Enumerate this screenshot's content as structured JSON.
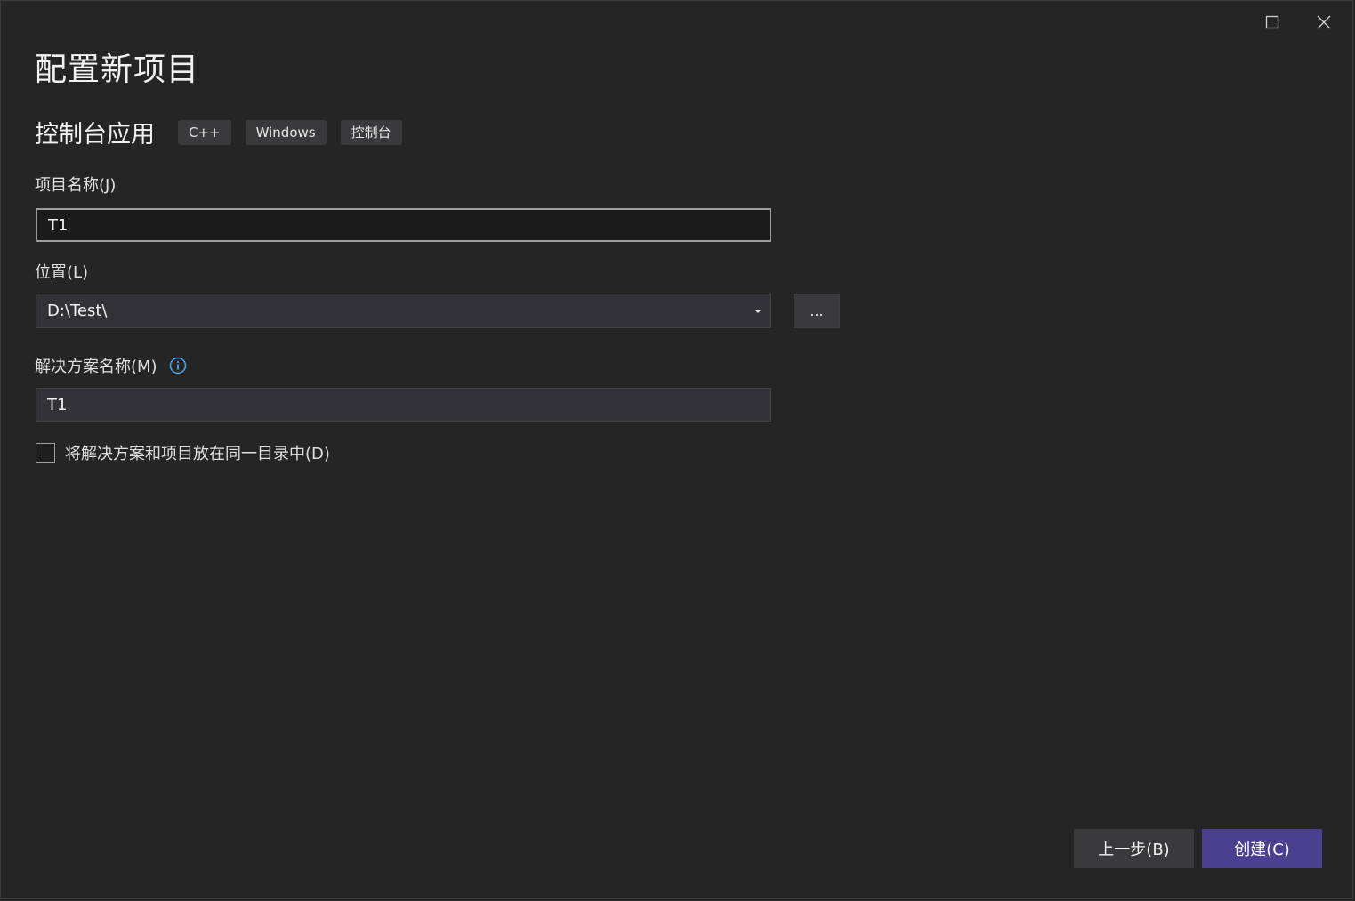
{
  "window": {
    "title": "配置新项目",
    "controls": {
      "maximize": "maximize-icon",
      "close": "close-icon"
    }
  },
  "template": {
    "name": "控制台应用",
    "tags": [
      "C++",
      "Windows",
      "控制台"
    ]
  },
  "form": {
    "project_name": {
      "label": "项目名称(J)",
      "value": "T1"
    },
    "location": {
      "label": "位置(L)",
      "value": "D:\\Test\\",
      "browse_label": "..."
    },
    "solution_name": {
      "label": "解决方案名称(M)",
      "value": "T1",
      "info_icon": "info-icon"
    },
    "same_dir_checkbox": {
      "label": "将解决方案和项目放在同一目录中(D)",
      "checked": false
    }
  },
  "footer": {
    "back_label": "上一步(B)",
    "create_label": "创建(C)"
  },
  "colors": {
    "background": "#252526",
    "primary_button": "#4b3f8f",
    "info_icon": "#4aa8e8"
  }
}
